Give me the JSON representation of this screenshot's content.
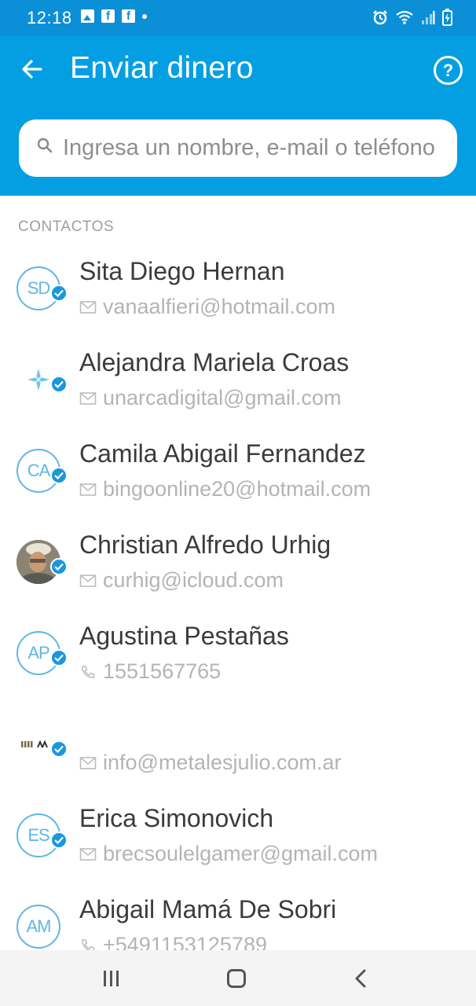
{
  "status_bar": {
    "time": "12:18",
    "left_icons": [
      "image-icon",
      "facebook-icon",
      "facebook-icon",
      "dot-icon"
    ],
    "right_icons": [
      "alarm-icon",
      "wifi-icon",
      "signal-icon",
      "battery-icon"
    ]
  },
  "header": {
    "title": "Enviar dinero",
    "help_label": "?"
  },
  "search": {
    "placeholder": "Ingresa un nombre, e-mail o teléfono"
  },
  "contacts_header": "CONTACTOS",
  "contacts": [
    {
      "name": "Sita Diego Hernan",
      "initials": "SD",
      "avatar": "initials",
      "detail_type": "email",
      "detail": "vanaalfieri@hotmail.com"
    },
    {
      "name": "Alejandra Mariela Croas",
      "initials": "",
      "avatar": "logo-star",
      "detail_type": "email",
      "detail": "unarcadigital@gmail.com"
    },
    {
      "name": "Camila Abigail Fernandez",
      "initials": "CA",
      "avatar": "initials",
      "detail_type": "email",
      "detail": "bingoonline20@hotmail.com"
    },
    {
      "name": "Christian Alfredo Urhig",
      "initials": "",
      "avatar": "photo",
      "detail_type": "email",
      "detail": "curhig@icloud.com"
    },
    {
      "name": "Agustina Pestañas",
      "initials": "AP",
      "avatar": "initials",
      "detail_type": "phone",
      "detail": "1551567765"
    },
    {
      "name": "",
      "initials": "",
      "avatar": "logo-bars",
      "detail_type": "email",
      "detail": "info@metalesjulio.com.ar"
    },
    {
      "name": "Erica Simonovich",
      "initials": "ES",
      "avatar": "initials",
      "detail_type": "email",
      "detail": "brecsoulelgamer@gmail.com"
    },
    {
      "name": "Abigail Mamá De Sobri",
      "initials": "AM",
      "avatar": "initials",
      "detail_type": "phone",
      "detail": "+5491153125789"
    }
  ],
  "colors": {
    "status_bar": "#0b8fd6",
    "app_bar": "#049fe3",
    "badge": "#1a97de",
    "initials": "#5fb7e5"
  },
  "nav": {
    "icons": [
      "recents-icon",
      "home-icon",
      "back-nav-icon"
    ]
  }
}
